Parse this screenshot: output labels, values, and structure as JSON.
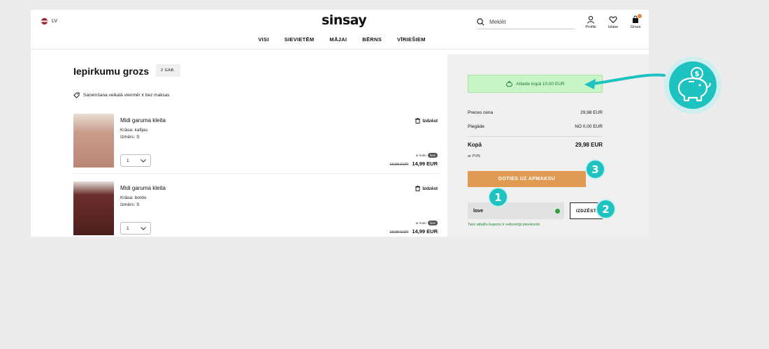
{
  "header": {
    "lang": "LV",
    "logo": "sinsay",
    "search_placeholder": "Meklēt",
    "icons": [
      {
        "label": "Profils",
        "icon": "user-icon"
      },
      {
        "label": "Izlase",
        "icon": "heart-icon"
      },
      {
        "label": "Grozs",
        "icon": "bag-icon"
      }
    ],
    "nav": [
      "VISI",
      "SIEVIETĒM",
      "MĀJAI",
      "BĒRNS",
      "VĪRIEŠIEM"
    ]
  },
  "cart": {
    "title": "Iepirkumu grozs",
    "count": "2 GAB.",
    "note": "Saņemšana veikalā vienmēr ir bez maksas",
    "items": [
      {
        "name": "Midi garuma kleita",
        "color": "Krāsa: kafijas",
        "size": "Izmērs: S",
        "qty": "1",
        "delete": "Izdzēst",
        "code_prefix": "ar kodu",
        "code": "love",
        "old_price": "19,99 EUR",
        "new_price": "14,99 EUR"
      },
      {
        "name": "Midi garuma kleita",
        "color": "Krāsa: bordo",
        "size": "Izmērs: S",
        "qty": "1",
        "delete": "Izdzēst",
        "code_prefix": "ar kodu",
        "code": "love",
        "old_price": "19,99 EUR",
        "new_price": "14,99 EUR"
      }
    ]
  },
  "summary": {
    "discount": "Atlaide kopā 10,00 EUR",
    "rows": [
      {
        "label": "Preces cena",
        "value": "29,98 EUR"
      },
      {
        "label": "Piegāde",
        "value": "NO 0,00 EUR"
      }
    ],
    "total_label": "Kopā",
    "total_value": "29,98 EUR",
    "vat": "ar PVN",
    "checkout": "DOTIES UZ APMAKSU",
    "coupon_value": "love",
    "coupon_clear": "IZDZĒST",
    "coupon_msg": "Tavs atlaižu kupons ir veiksmīgi pievienots"
  },
  "annotations": {
    "step1": "1",
    "step2": "2",
    "step3": "3"
  },
  "colors": {
    "accent_orange": "#e09a52",
    "annotation_teal": "#1ec2c1",
    "success_green": "#c8f5c8"
  }
}
